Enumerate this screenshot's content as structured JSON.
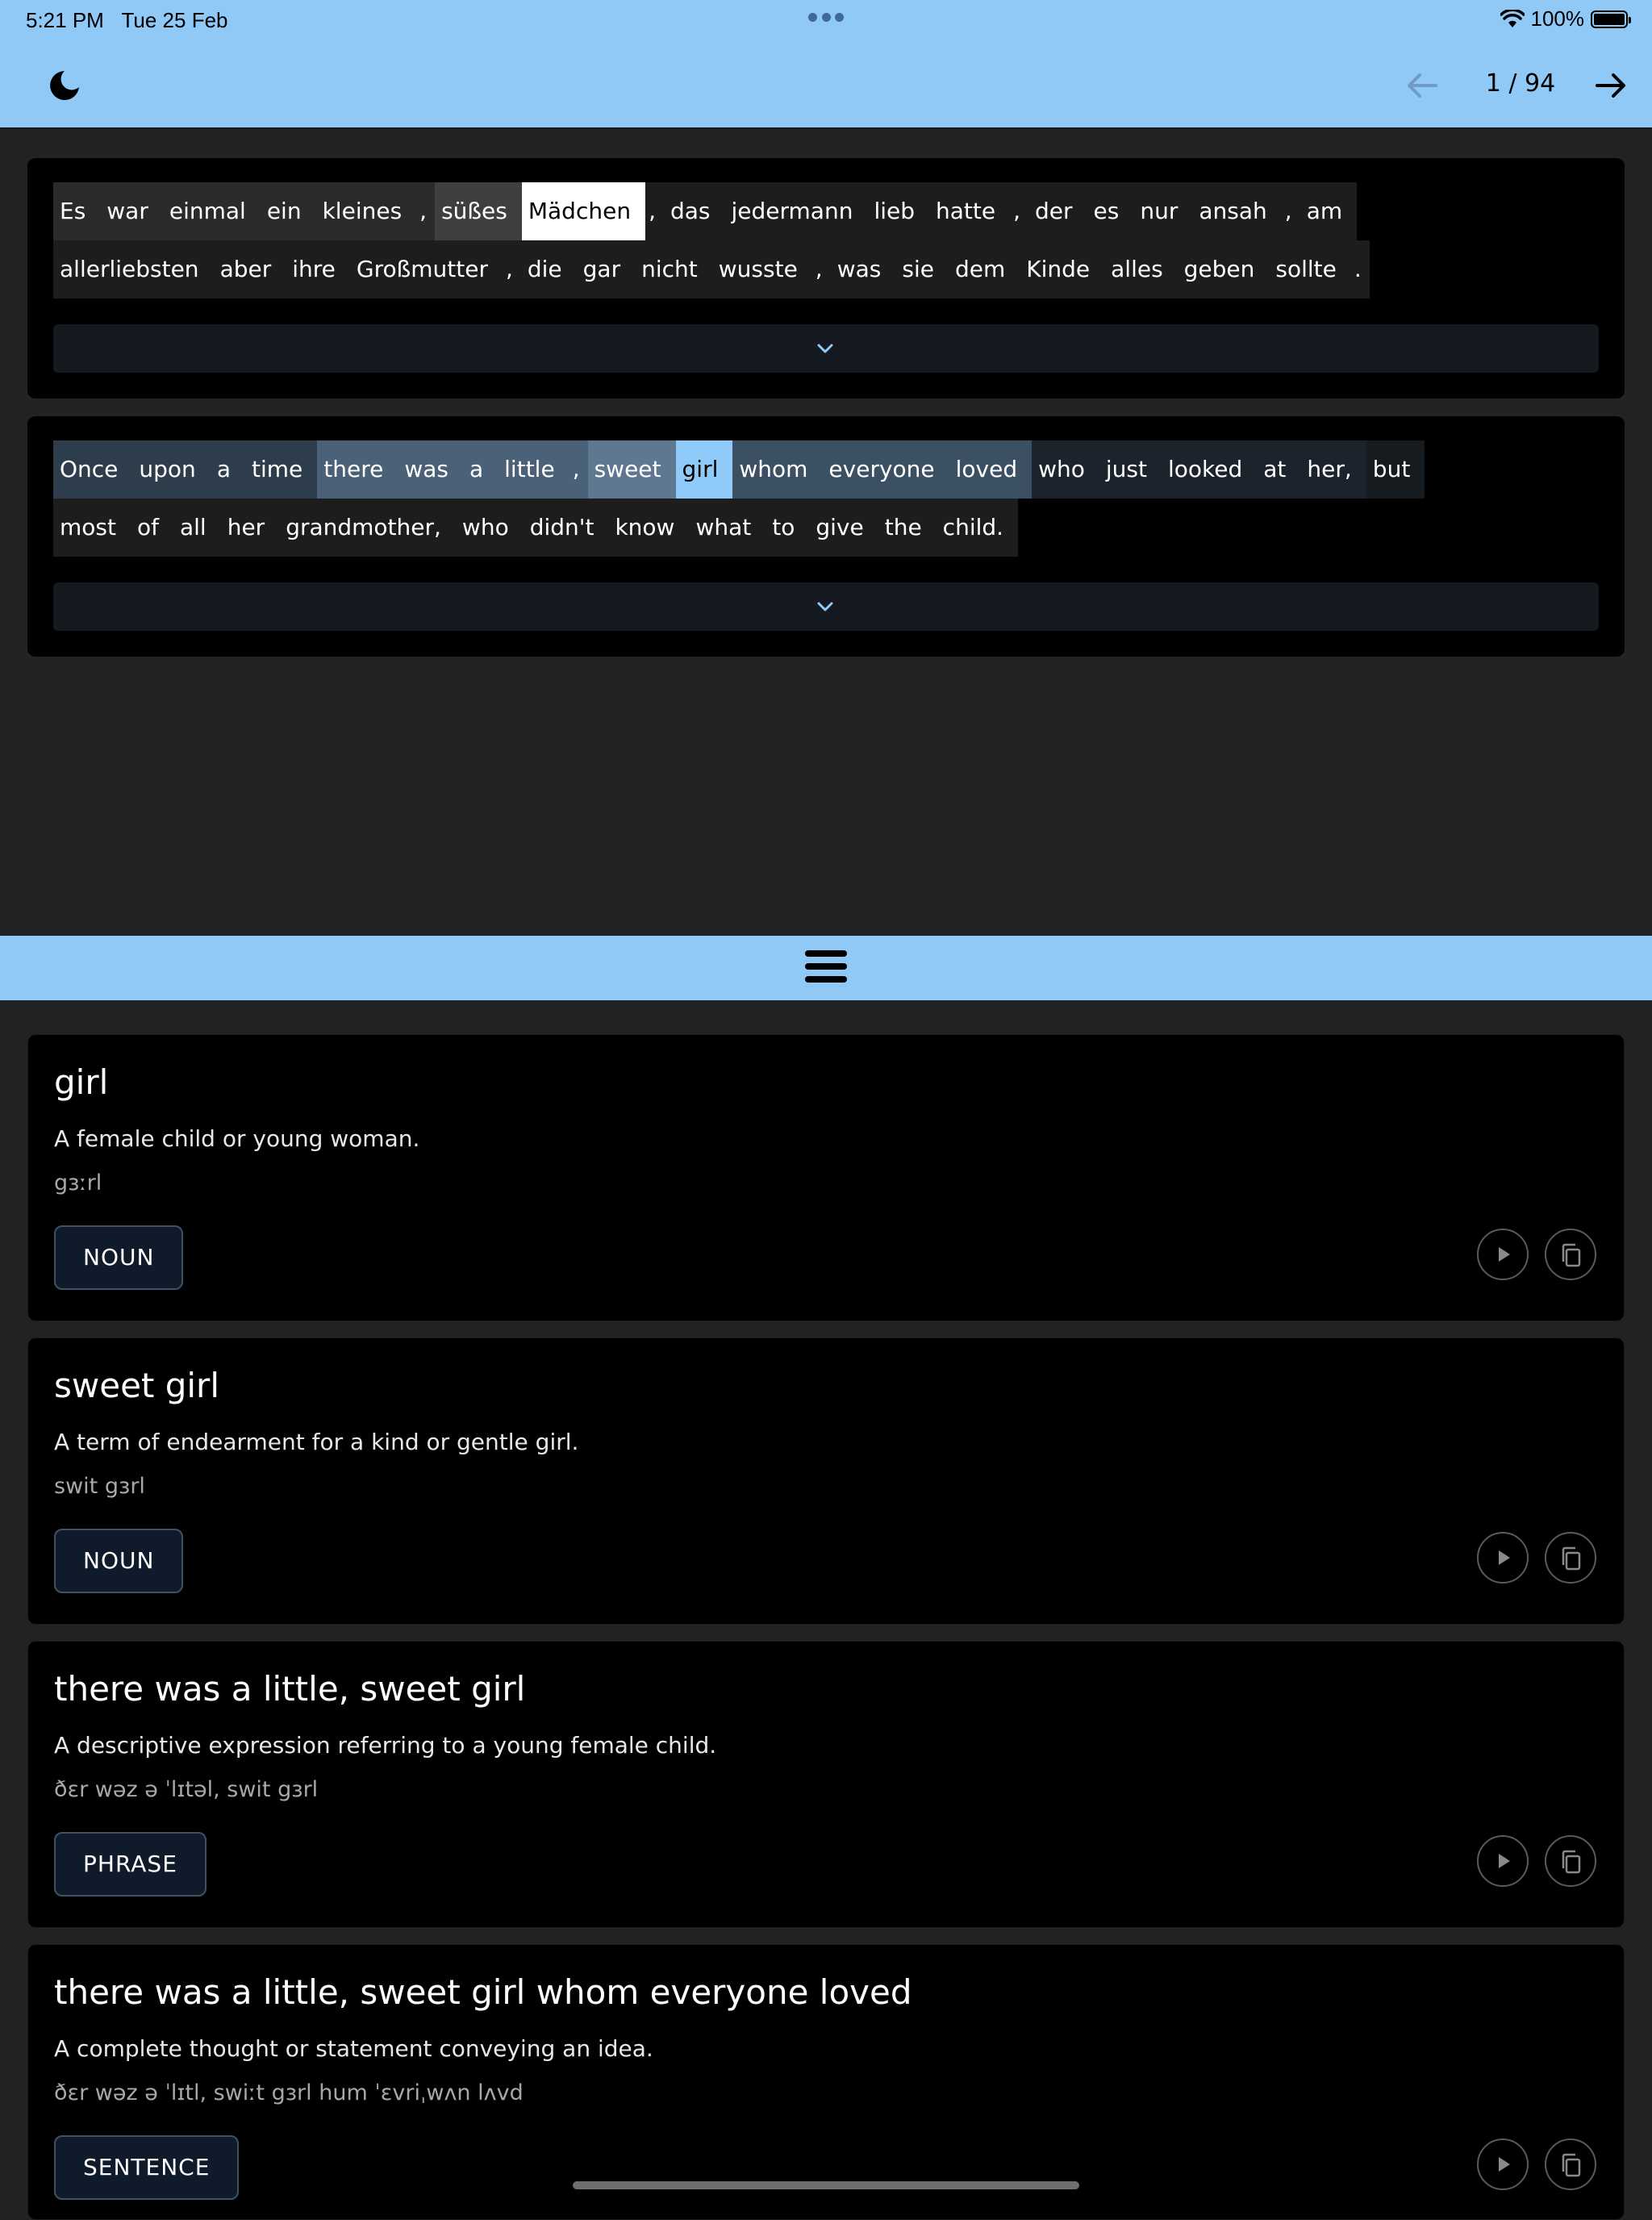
{
  "status": {
    "time": "5:21 PM",
    "date": "Tue 25 Feb",
    "battery": "100%"
  },
  "toolbar": {
    "theme_icon": "moon-icon",
    "prev_icon": "arrow-left-icon",
    "next_icon": "arrow-right-icon",
    "page_current": 1,
    "page_total": 94,
    "page_counter": "1 / 94"
  },
  "colors": {
    "accent": "#90c8f6",
    "background": "#232323",
    "card": "#000000",
    "selected": "#90caf9"
  },
  "source_text": {
    "rows": [
      [
        [
          "Es",
          "#2a2a2a"
        ],
        [
          "war",
          "#2a2a2a"
        ],
        [
          "einmal",
          "#2a2a2a"
        ],
        [
          "ein",
          "#2a2a2a"
        ],
        [
          "kleines",
          "#2a2a2a"
        ],
        [
          ",",
          "#2a2a2a"
        ],
        [
          "süßes",
          "#3f3f3f"
        ],
        [
          "Mädchen",
          "#ffffff"
        ],
        [
          ",",
          "#1d1d1d"
        ],
        [
          "das",
          "#1d1d1d"
        ],
        [
          "jedermann",
          "#1d1d1d"
        ],
        [
          "lieb",
          "#1d1d1d"
        ],
        [
          "hatte",
          "#1d1d1d"
        ],
        [
          ",",
          "#1d1d1d"
        ],
        [
          "der",
          "#1d1d1d"
        ],
        [
          "es",
          "#1d1d1d"
        ],
        [
          "nur",
          "#1d1d1d"
        ],
        [
          "ansah",
          "#1d1d1d"
        ],
        [
          ",",
          "#1d1d1d"
        ],
        [
          "am",
          "#1d1d1d"
        ]
      ],
      [
        [
          "allerliebsten",
          "#1d1d1d"
        ],
        [
          "aber",
          "#1d1d1d"
        ],
        [
          "ihre",
          "#1d1d1d"
        ],
        [
          "Großmutter",
          "#1d1d1d"
        ],
        [
          ",",
          "#1d1d1d"
        ],
        [
          "die",
          "#1d1d1d"
        ],
        [
          "gar",
          "#1d1d1d"
        ],
        [
          "nicht",
          "#1d1d1d"
        ],
        [
          "wusste",
          "#1d1d1d"
        ],
        [
          ",",
          "#1d1d1d"
        ],
        [
          "was",
          "#1d1d1d"
        ],
        [
          "sie",
          "#1d1d1d"
        ],
        [
          "dem",
          "#1d1d1d"
        ],
        [
          "Kinde",
          "#1d1d1d"
        ],
        [
          "alles",
          "#1d1d1d"
        ],
        [
          "geben",
          "#1d1d1d"
        ],
        [
          "sollte",
          "#1d1d1d"
        ],
        [
          ".",
          "#1d1d1d"
        ]
      ]
    ],
    "expand_icon": "chevron-down-icon"
  },
  "translation_text": {
    "rows": [
      [
        [
          "Once",
          "#2e3d4b"
        ],
        [
          "upon",
          "#2e3d4b"
        ],
        [
          "a",
          "#2e3d4b"
        ],
        [
          "time",
          "#2e3d4b"
        ],
        [
          "there",
          "#4b6178"
        ],
        [
          "was",
          "#4b6178"
        ],
        [
          "a",
          "#4b6178"
        ],
        [
          "little",
          "#4b6178"
        ],
        [
          ",",
          "#4b6178"
        ],
        [
          "sweet",
          "#5e7891"
        ],
        [
          "girl",
          "#90caf9"
        ],
        [
          "whom",
          "#3c5064"
        ],
        [
          "everyone",
          "#3c5064"
        ],
        [
          "loved",
          "#3c5064"
        ],
        [
          "who",
          "#1b242c"
        ],
        [
          "just",
          "#1b242c"
        ],
        [
          "looked",
          "#1b242c"
        ],
        [
          "at",
          "#1b242c"
        ],
        [
          "her,",
          "#1b242c"
        ],
        [
          "but",
          "#161b20"
        ]
      ],
      [
        [
          "most",
          "#1d1d1d"
        ],
        [
          "of",
          "#1d1d1d"
        ],
        [
          "all",
          "#1d1d1d"
        ],
        [
          "her",
          "#1d1d1d"
        ],
        [
          "grandmother,",
          "#1d1d1d"
        ],
        [
          "who",
          "#1d1d1d"
        ],
        [
          "didn't",
          "#1d1d1d"
        ],
        [
          "know",
          "#1d1d1d"
        ],
        [
          "what",
          "#1d1d1d"
        ],
        [
          "to",
          "#1d1d1d"
        ],
        [
          "give",
          "#1d1d1d"
        ],
        [
          "the",
          "#1d1d1d"
        ],
        [
          "child.",
          "#1d1d1d"
        ]
      ]
    ],
    "expand_icon": "chevron-down-icon"
  },
  "divider_icon": "menu-icon",
  "entries": [
    {
      "title": "girl",
      "definition": "A female child or young woman.",
      "ipa": "gɜːrl",
      "pos": "NOUN"
    },
    {
      "title": "sweet girl",
      "definition": "A term of endearment for a kind or gentle girl.",
      "ipa": "swit gɜrl",
      "pos": "NOUN"
    },
    {
      "title": "there was a little, sweet girl",
      "definition": "A descriptive expression referring to a young female child.",
      "ipa": "ðɛr wəz ə ˈlɪtəl, swit gɜrl",
      "pos": "PHRASE"
    },
    {
      "title": "there was a little, sweet girl whom everyone loved",
      "definition": "A complete thought or statement conveying an idea.",
      "ipa": "ðɛr wəz ə ˈlɪtl, swiːt gɜrl hum ˈɛvriˌwʌn lʌvd",
      "pos": "SENTENCE"
    }
  ],
  "entry_actions": {
    "play_icon": "play-icon",
    "copy_icon": "copy-icon"
  }
}
